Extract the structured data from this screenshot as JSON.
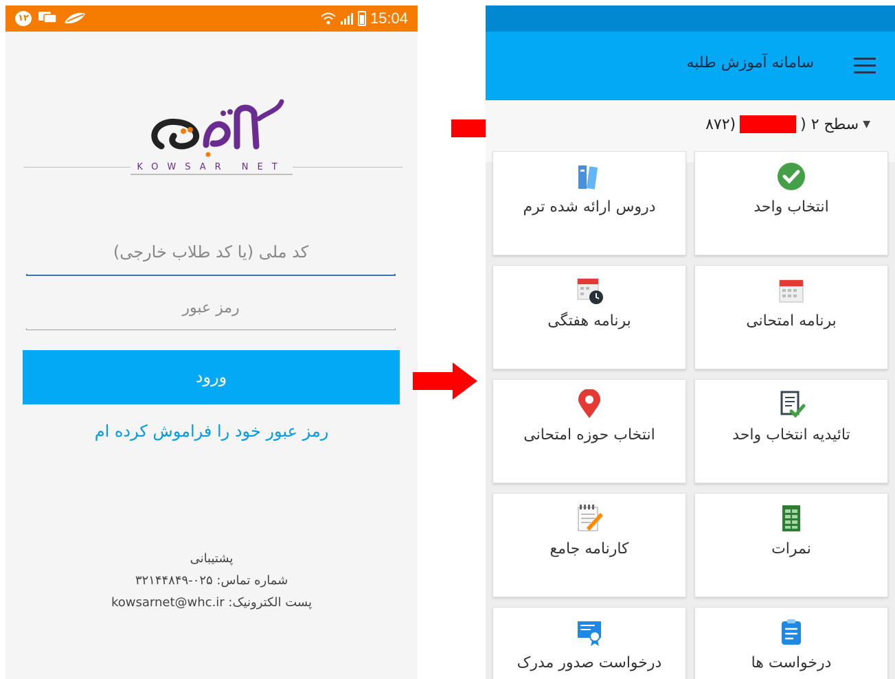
{
  "login_screen": {
    "status_bar": {
      "badge": "۱۲",
      "time": "15:04"
    },
    "logo": {
      "subtitle": "KOWSAR NET"
    },
    "national_code_placeholder": "کد ملی (یا کد طلاب خارجی)",
    "password_placeholder": "رمز عبور",
    "login_label": "ورود",
    "forgot_label": "رمز عبور خود را فراموش کرده ام",
    "support": {
      "title": "پشتیبانی",
      "phone": "شماره تماس: ۰۲۵-۳۲۱۴۴۸۴۹",
      "email": "پست الکترونیک: kowsarnet@whc.ir"
    }
  },
  "dashboard": {
    "app_title": "سامانه آموزش طلبه",
    "level": {
      "label": "سطح ۲ (",
      "suffix": "(۸۷۲"
    },
    "tiles": [
      {
        "label": "انتخاب واحد",
        "icon": "check-circle-icon"
      },
      {
        "label": "دروس ارائه شده ترم",
        "icon": "books-icon"
      },
      {
        "label": "برنامه امتحانی",
        "icon": "calendar-icon"
      },
      {
        "label": "برنامه هفتگی",
        "icon": "calendar-clock-icon"
      },
      {
        "label": "تائیدیه انتخاب واحد",
        "icon": "document-check-icon"
      },
      {
        "label": "انتخاب حوزه امتحانی",
        "icon": "location-pin-icon"
      },
      {
        "label": "نمرات",
        "icon": "spreadsheet-icon"
      },
      {
        "label": "کارنامه جامع",
        "icon": "notepad-pencil-icon"
      },
      {
        "label": "درخواست ها",
        "icon": "request-document-icon"
      },
      {
        "label": "درخواست صدور مدرک",
        "icon": "certificate-icon"
      }
    ]
  },
  "colors": {
    "login_status_bar": "#f57c00",
    "primary_blue": "#03a9f4",
    "link_blue": "#039be5",
    "arrow_red": "#ff0000"
  }
}
